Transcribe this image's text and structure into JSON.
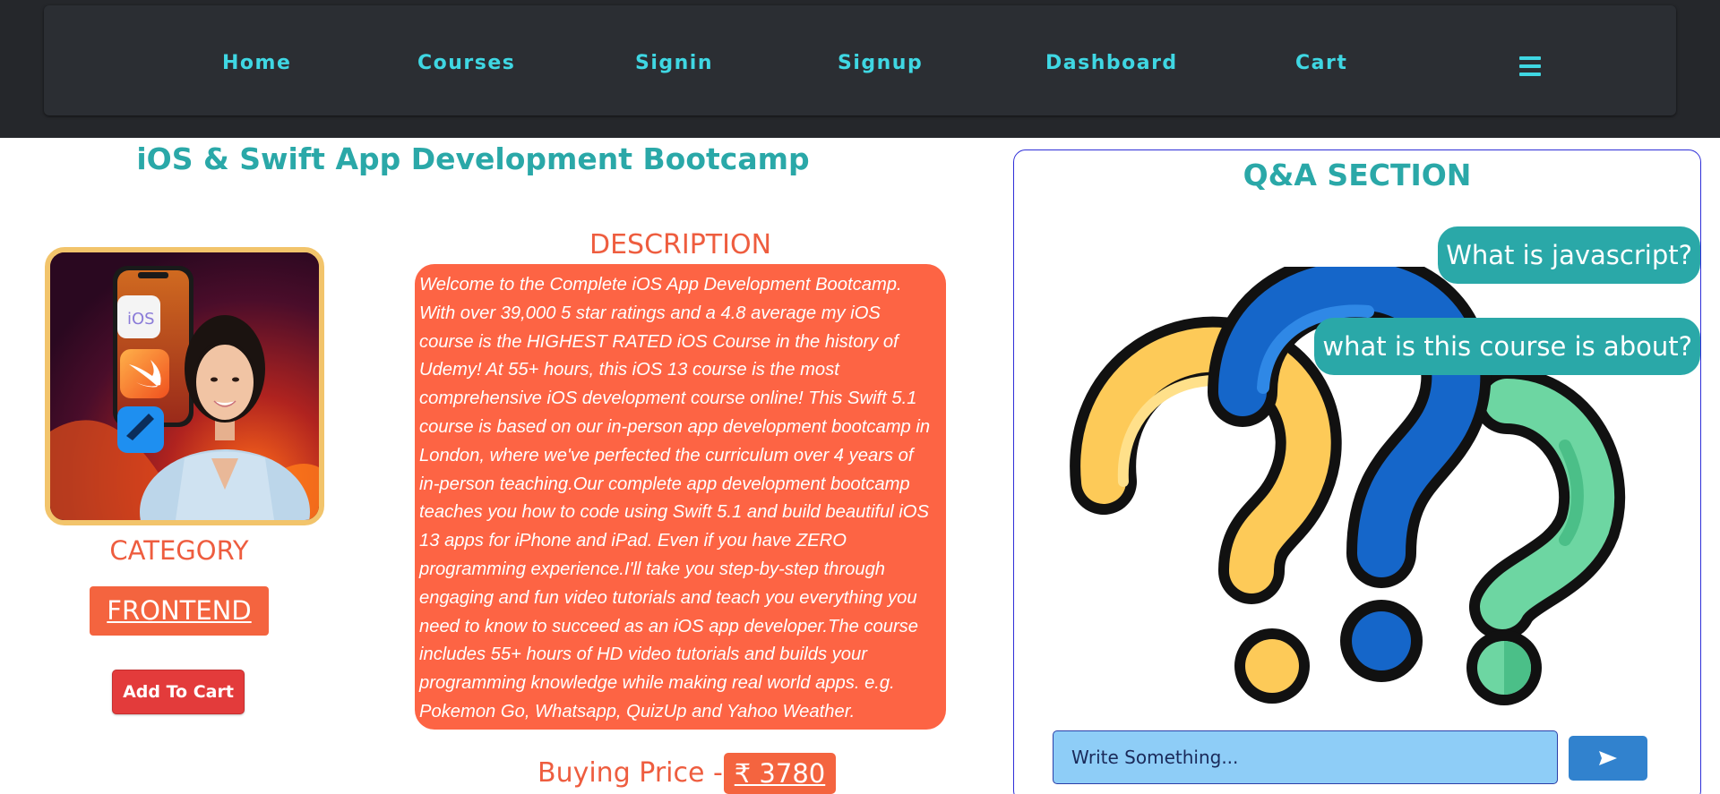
{
  "nav": {
    "items": [
      "Home",
      "Courses",
      "Signin",
      "Signup",
      "Dashboard",
      "Cart"
    ],
    "menu_icon": "hamburger-icon",
    "link_color": "#3fd7e3"
  },
  "course": {
    "title": "iOS & Swift App Development Bootcamp",
    "category_label": "CATEGORY",
    "category": "FRONTEND",
    "add_to_cart": "Add To Cart",
    "description_heading": "DESCRIPTION",
    "description_lines": [
      "Welcome to the Complete iOS App Development Bootcamp.",
      "With over 39,000 5 star ratings and a 4.8 average my iOS",
      "course is the HIGHEST RATED iOS Course in the history of",
      "Udemy! At 55+ hours, this iOS 13 course is the most",
      "comprehensive iOS development course online! This Swift 5.1",
      "course is based on our in-person app development bootcamp in",
      "London, where we've perfected the curriculum over 4 years of",
      "in-person teaching.Our complete app development bootcamp",
      "teaches you how to code using Swift 5.1 and build beautiful iOS",
      "13 apps for iPhone and iPad. Even if you have ZERO",
      "programming experience.I'll take you step-by-step through",
      "engaging and fun video tutorials and teach you everything you",
      "need to know to succeed as an iOS app developer.The course",
      "includes 55+ hours of HD video tutorials and builds your",
      "programming knowledge while making real world apps. e.g.",
      "Pokemon Go, Whatsapp, QuizUp and Yahoo Weather."
    ],
    "price_label": "Buying Price -",
    "price": "₹ 3780"
  },
  "qa": {
    "title": "Q&A SECTION",
    "questions": [
      "What is javascript?",
      "what is this course is about?"
    ],
    "input_placeholder": "Write Something...",
    "send_icon": "send-icon"
  },
  "colors": {
    "accent_teal": "#2aa8a8",
    "orange": "#fd6444",
    "nav_bg": "#25272b",
    "cart_red": "#e33b3b"
  }
}
